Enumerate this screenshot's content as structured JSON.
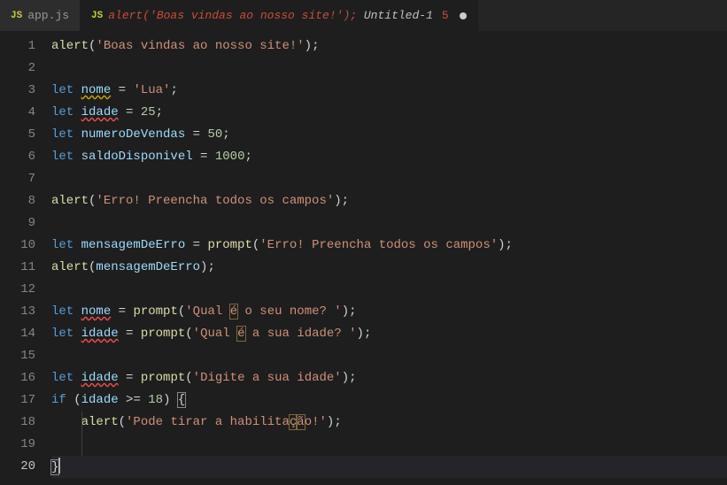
{
  "tabs": [
    {
      "icon": "JS",
      "label": "app.js",
      "active": false,
      "dirty": false,
      "problems": null
    },
    {
      "icon": "JS",
      "label_red": "alert('Boas vindas ao nosso site!');",
      "label_suffix": " Untitled-1",
      "problems": "5",
      "active": true,
      "dirty": true
    }
  ],
  "code": {
    "lines": [
      {
        "n": "1",
        "t": [
          [
            "fn",
            "alert"
          ],
          [
            "pun",
            "("
          ],
          [
            "str",
            "'Boas vindas ao nosso site!'"
          ],
          [
            "pun",
            ")"
          ],
          [
            "pun",
            ";"
          ]
        ]
      },
      {
        "n": "2",
        "t": []
      },
      {
        "n": "3",
        "t": [
          [
            "kw",
            "let "
          ],
          [
            "var squiggle-warn",
            "nome"
          ],
          [
            "pun",
            " = "
          ],
          [
            "str",
            "'Lua'"
          ],
          [
            "pun",
            ";"
          ]
        ]
      },
      {
        "n": "4",
        "t": [
          [
            "kw",
            "let "
          ],
          [
            "var squiggle-error",
            "idade"
          ],
          [
            "pun",
            " = "
          ],
          [
            "num",
            "25"
          ],
          [
            "pun",
            ";"
          ]
        ]
      },
      {
        "n": "5",
        "t": [
          [
            "kw",
            "let "
          ],
          [
            "var",
            "numeroDeVendas"
          ],
          [
            "pun",
            " = "
          ],
          [
            "num",
            "50"
          ],
          [
            "pun",
            ";"
          ]
        ]
      },
      {
        "n": "6",
        "t": [
          [
            "kw",
            "let "
          ],
          [
            "var",
            "saldoDisponivel"
          ],
          [
            "pun",
            " = "
          ],
          [
            "num",
            "1000"
          ],
          [
            "pun",
            ";"
          ]
        ]
      },
      {
        "n": "7",
        "t": []
      },
      {
        "n": "8",
        "t": [
          [
            "fn",
            "alert"
          ],
          [
            "pun",
            "("
          ],
          [
            "str",
            "'Erro! Preencha todos os campos'"
          ],
          [
            "pun",
            ")"
          ],
          [
            "pun",
            ";"
          ]
        ]
      },
      {
        "n": "9",
        "t": []
      },
      {
        "n": "10",
        "t": [
          [
            "kw",
            "let "
          ],
          [
            "var",
            "mensagemDeErro"
          ],
          [
            "pun",
            " = "
          ],
          [
            "fn",
            "prompt"
          ],
          [
            "pun",
            "("
          ],
          [
            "str",
            "'Erro! Preencha todos os campos'"
          ],
          [
            "pun",
            ")"
          ],
          [
            "pun",
            ";"
          ]
        ]
      },
      {
        "n": "11",
        "t": [
          [
            "fn",
            "alert"
          ],
          [
            "pun",
            "("
          ],
          [
            "var",
            "mensagemDeErro"
          ],
          [
            "pun",
            ")"
          ],
          [
            "pun",
            ";"
          ]
        ]
      },
      {
        "n": "12",
        "t": []
      },
      {
        "n": "13",
        "t": [
          [
            "kw",
            "let "
          ],
          [
            "var squiggle-error",
            "nome"
          ],
          [
            "pun",
            " = "
          ],
          [
            "fn",
            "prompt"
          ],
          [
            "pun",
            "("
          ],
          [
            "str",
            "'Qual "
          ],
          [
            "str char-highlight",
            "é"
          ],
          [
            "str",
            " o seu nome? '"
          ],
          [
            "pun",
            ")"
          ],
          [
            "pun",
            ";"
          ]
        ]
      },
      {
        "n": "14",
        "t": [
          [
            "kw",
            "let "
          ],
          [
            "var squiggle-error",
            "idade"
          ],
          [
            "pun",
            " = "
          ],
          [
            "fn",
            "prompt"
          ],
          [
            "pun",
            "("
          ],
          [
            "str",
            "'Qual "
          ],
          [
            "str char-highlight",
            "é"
          ],
          [
            "str",
            " a sua idade? '"
          ],
          [
            "pun",
            ")"
          ],
          [
            "pun",
            ";"
          ]
        ]
      },
      {
        "n": "15",
        "t": []
      },
      {
        "n": "16",
        "t": [
          [
            "kw",
            "let "
          ],
          [
            "var squiggle-error",
            "idade"
          ],
          [
            "pun",
            " = "
          ],
          [
            "fn",
            "prompt"
          ],
          [
            "pun",
            "("
          ],
          [
            "str",
            "'Digite a sua idade'"
          ],
          [
            "pun",
            ")"
          ],
          [
            "pun",
            ";"
          ]
        ]
      },
      {
        "n": "17",
        "t": [
          [
            "kw",
            "if"
          ],
          [
            "pun",
            " ("
          ],
          [
            "var",
            "idade"
          ],
          [
            "pun",
            " >= "
          ],
          [
            "num",
            "18"
          ],
          [
            "pun",
            ") "
          ],
          [
            "pun bracket-match",
            "{"
          ]
        ]
      },
      {
        "n": "18",
        "t": [
          [
            "guide",
            ""
          ],
          [
            "pun",
            "    "
          ],
          [
            "fn",
            "alert"
          ],
          [
            "pun",
            "("
          ],
          [
            "str",
            "'Pode tirar a habilita"
          ],
          [
            "str char-highlight",
            "ç"
          ],
          [
            "str char-highlight",
            "ã"
          ],
          [
            "str",
            "o!'"
          ],
          [
            "pun",
            ")"
          ],
          [
            "pun",
            ";"
          ]
        ]
      },
      {
        "n": "19",
        "t": [
          [
            "guide",
            ""
          ]
        ]
      },
      {
        "n": "20",
        "t": [
          [
            "pun bracket-match",
            "}"
          ],
          [
            "cursor",
            ""
          ]
        ],
        "current": true
      }
    ]
  }
}
